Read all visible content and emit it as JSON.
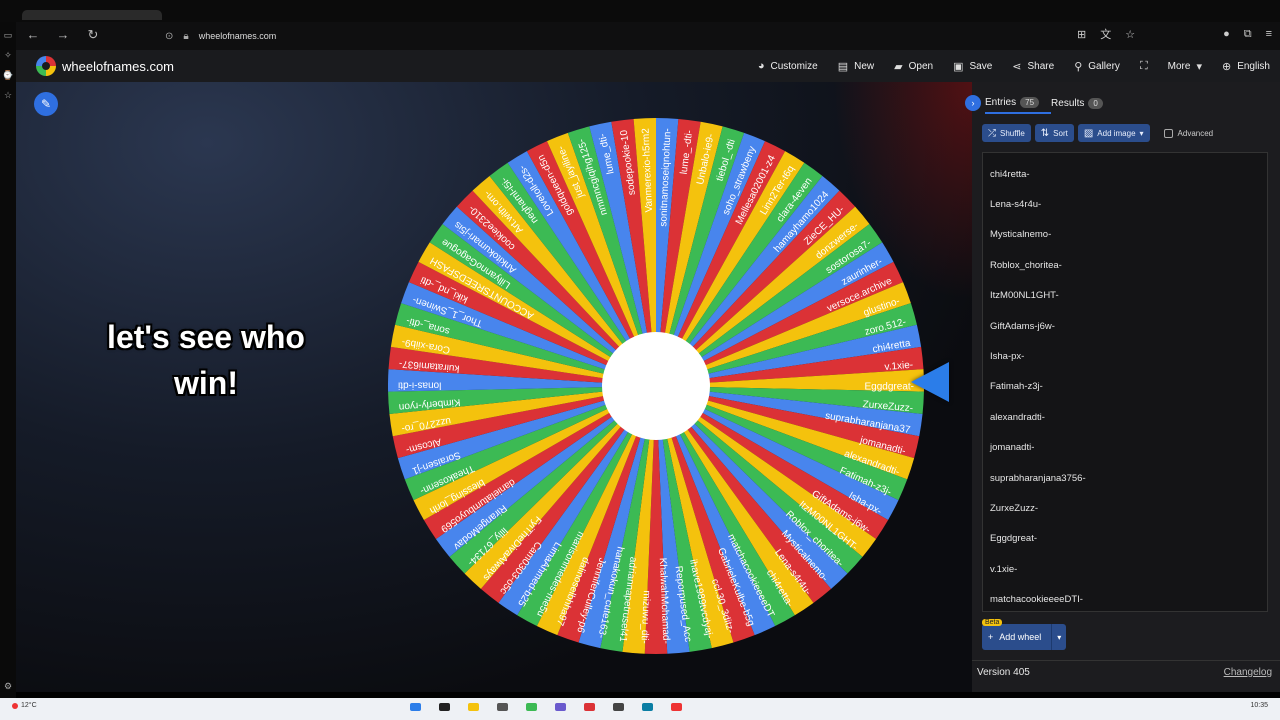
{
  "browser": {
    "url": "wheelofnames.com",
    "nav": {
      "back": "←",
      "forward": "→",
      "reload": "↻"
    }
  },
  "app": {
    "brand": "wheelofnames.com",
    "menu": [
      {
        "name": "customize",
        "label": "Customize",
        "icon": "palette-icon"
      },
      {
        "name": "new",
        "label": "New",
        "icon": "file-icon"
      },
      {
        "name": "open",
        "label": "Open",
        "icon": "folder-icon"
      },
      {
        "name": "save",
        "label": "Save",
        "icon": "save-icon"
      },
      {
        "name": "share",
        "label": "Share",
        "icon": "share-icon"
      },
      {
        "name": "gallery",
        "label": "Gallery",
        "icon": "search-icon"
      },
      {
        "name": "fullscreen",
        "label": "",
        "icon": "fullscreen-icon"
      },
      {
        "name": "more",
        "label": "More",
        "icon": "chevron-down-icon"
      },
      {
        "name": "language",
        "label": "English",
        "icon": "globe-icon"
      }
    ]
  },
  "stage": {
    "caption_line1": "let's see who",
    "caption_line2": "win!",
    "colors": {
      "red": "#db3236",
      "yellow": "#f4c20d",
      "green": "#3cba54",
      "blue": "#4885ed",
      "pointer": "#2b7de9"
    },
    "wheel_labels_right": [
      "v.1xie-",
      "Eggdgreat-",
      "ZurxeZuzz-",
      "suprabharanjana37",
      "jomanadti-",
      "alexandradti-",
      "Fatimah-z3j-",
      "Isha-px-",
      "GiftAdams-j6w-",
      "ItzM00NL1GHT-",
      "Roblox_choritea-",
      "Mysticalnemo-",
      "Lena-s4r4u-",
      "chi4retta-",
      "matchacookieeeeDT",
      "GabrieleKulbe-b5g",
      "ccl.30_3ditz-",
      "ihave1989tvcdyaj-",
      "Reporpused_Acc",
      "KhalwahMohamad-",
      "mizuwu_dti-",
      "adriannapetrusel41",
      "hanakokun_cute163-",
      "JenniferCulley-p6",
      "dalinoselbhha97",
      "marisonmedes-me5u",
      "LimaAhmed-b25",
      "Cam0303-o5c",
      "FyiTheDivaAlways",
      "lilly_67134-",
      "RirangeModav",
      "danielatumbuyo569"
    ],
    "wheel_labels_left": [
      "blessing_lorih",
      "Theakosenn-",
      "Soraisen-j1",
      "Alcosm-",
      "uzz270_ro-",
      "Kimberly-ryon",
      "lonas-i-dti",
      "kuiratami637-",
      "Cora-xiib9-",
      "sona_-dti-",
      "Thor_1_Swinen-",
      "kiki_nd_-dti",
      "ACCOUNTSREEDSFASH",
      "LillyannoGagogue",
      "Ankitokumari-j5is",
      "cookiee2310-",
      "Art.with.om-",
      "neghaml-i5i-",
      "Lovetoll-d2s-",
      "goldqueen-d5n",
      "just_jayiline-",
      "nmmncgiqihg125-",
      "lume_dti-",
      "sodepookie-10",
      "Vanmerexio-h5rm2",
      "sonitnamoseiqnohtun-",
      "lume_-dti-",
      "Unbalo-ie9-",
      "tiebol_-dti",
      "soho_strawbeny",
      "Mellesa02001-z4",
      "Linn2Ter-t6q",
      "clara-4even",
      "hamayhamo1024",
      "ZieCE_HU-",
      "donzwerse-",
      "sostorosa7-",
      "zaurinher-",
      "versoce.archive",
      "glustino-",
      "zoro.512-",
      "chi4retta"
    ]
  },
  "panel": {
    "tabs": [
      {
        "label": "Entries",
        "count": "75"
      },
      {
        "label": "Results",
        "count": "0"
      }
    ],
    "tools": {
      "shuffle": "Shuffle",
      "sort": "Sort",
      "add_image": "Add image",
      "advanced": "Advanced"
    },
    "entries": [
      "chi4retta-",
      "Lena-s4r4u-",
      "Mysticalnemo-",
      "Roblox_choritea-",
      "ItzM00NL1GHT-",
      "GiftAdams-j6w-",
      "Isha-px-",
      "Fatimah-z3j-",
      "alexandradti-",
      "jomanadti-",
      "suprabharanjana3756-",
      "ZurxeZuzz-",
      "Eggdgreat-",
      "v.1xie-",
      "matchacookieeeeDTI-"
    ],
    "beta": "Beta",
    "add_wheel": "Add wheel",
    "version": "Version 405",
    "changelog": "Changelog"
  },
  "taskbar": {
    "weather": "12°C",
    "clock": "10:35"
  }
}
